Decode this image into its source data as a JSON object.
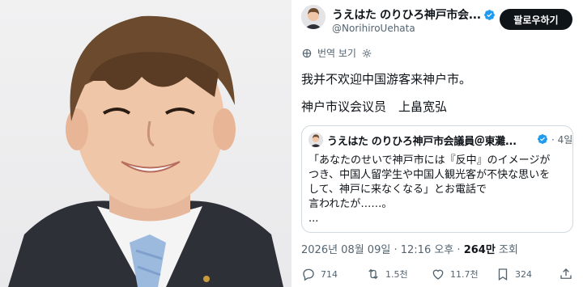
{
  "profile": {
    "display_name": "うえはた のりひろ神戸市会...",
    "handle": "@NorihiroUehata",
    "follow_label": "팔로우하기",
    "verified_color": "#1d9bf0"
  },
  "translate": {
    "label": "번역 보기"
  },
  "tweet": {
    "text": "我并不欢迎中国游客来神户市。",
    "signature": "神户市议会议员　上畠宽弘"
  },
  "quote": {
    "name": "うえはた のりひろ神戸市会議員＠東灘...",
    "separator": "·",
    "time": "4일",
    "lines": [
      "「あなたのせいで神戸市には『反中』のイメージが",
      "つき、中国人留学生や中国人観光客が不快な思いを",
      "して、神戸に来なくなる」とお電話で",
      "言われたが……。",
      "..."
    ]
  },
  "meta": {
    "date": "2026년 08월 09일",
    "separator": "·",
    "time": "12:16 오후",
    "views_count": "264만",
    "views_label": "조회"
  },
  "actions": {
    "reply_count": "714",
    "retweet_count": "1.5천",
    "like_count": "11.7천",
    "bookmark_count": "324"
  }
}
